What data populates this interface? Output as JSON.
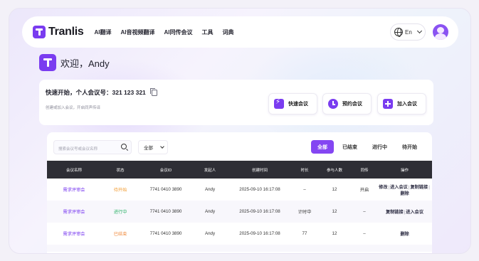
{
  "nav": {
    "brand": "Tranlis",
    "items": [
      "AI翻译",
      "AI音视频翻译",
      "AI同传会议",
      "工具",
      "词典"
    ],
    "lang": "En"
  },
  "welcome": {
    "text": "欢迎，Andy"
  },
  "quick": {
    "title": "快速开始，个人会议号：321 123 321",
    "subtitle": "创建或加入会议，开启同声传译",
    "buttons": {
      "instant": "快速会议",
      "schedule": "预约会议",
      "join": "加入会议"
    }
  },
  "list": {
    "search_placeholder": "搜索会议号或会议名称",
    "select_value": "全部",
    "filters": [
      "全部",
      "已结束",
      "进行中",
      "待开始"
    ],
    "columns": [
      "会议名称",
      "状态",
      "会议ID",
      "发起人",
      "创建时间",
      "时长",
      "参与人数",
      "同传",
      "操作"
    ],
    "rows": [
      {
        "name": "需求评审会",
        "status": "待开始",
        "id": "7741 0410 3890",
        "host": "Andy",
        "created": "2025-09-10 16:17:08",
        "duration": "–",
        "participants": "12",
        "interp": "开启",
        "ops": [
          "修改",
          "进入会议",
          "复制链接",
          "删除"
        ]
      },
      {
        "name": "需求评审会",
        "status": "进行中",
        "id": "7741 0410 3890",
        "host": "Andy",
        "created": "2025-09-10 16:17:08",
        "duration": "计时中",
        "participants": "12",
        "interp": "–",
        "ops": [
          "复制链接",
          "进入会议"
        ]
      },
      {
        "name": "需求评审会",
        "status": "已结束",
        "id": "7741 0410 3890",
        "host": "Andy",
        "created": "2025-09-10 16:17:08",
        "duration": "77",
        "participants": "12",
        "interp": "–",
        "ops": [
          "删除"
        ]
      }
    ]
  },
  "colors": {
    "accent": "#7a3cf0",
    "header_bg": "#2e2e35",
    "status_pending": "#f2a03a",
    "status_live": "#2fb36a",
    "status_ended": "#f08a3c"
  }
}
